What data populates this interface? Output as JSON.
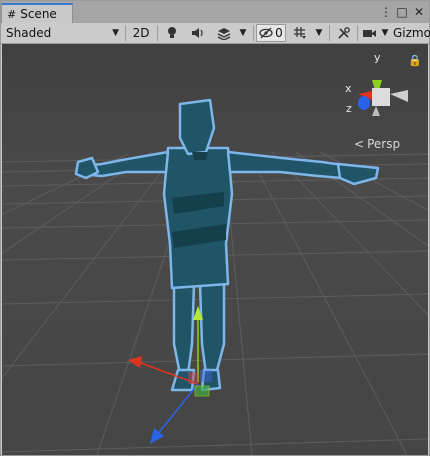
{
  "tab": {
    "label": "Scene",
    "icon": "grid-icon"
  },
  "window_controls": {
    "menu": "⋮",
    "maximize": "□",
    "close": "✕"
  },
  "toolbar": {
    "shading_mode": "Shaded",
    "mode_2d": "2D",
    "hidden_count": "0",
    "gizmos": "Gizmo"
  },
  "viewport": {
    "projection_label": "Persp",
    "axes": {
      "x": "x",
      "y": "y",
      "z": "z"
    },
    "colors": {
      "background": "#474747",
      "model": "#1f5566",
      "model_outline": "#7fb6ea",
      "x_axis": "#e0331e",
      "y_axis": "#8cd21c",
      "z_axis": "#2a62e8"
    }
  }
}
